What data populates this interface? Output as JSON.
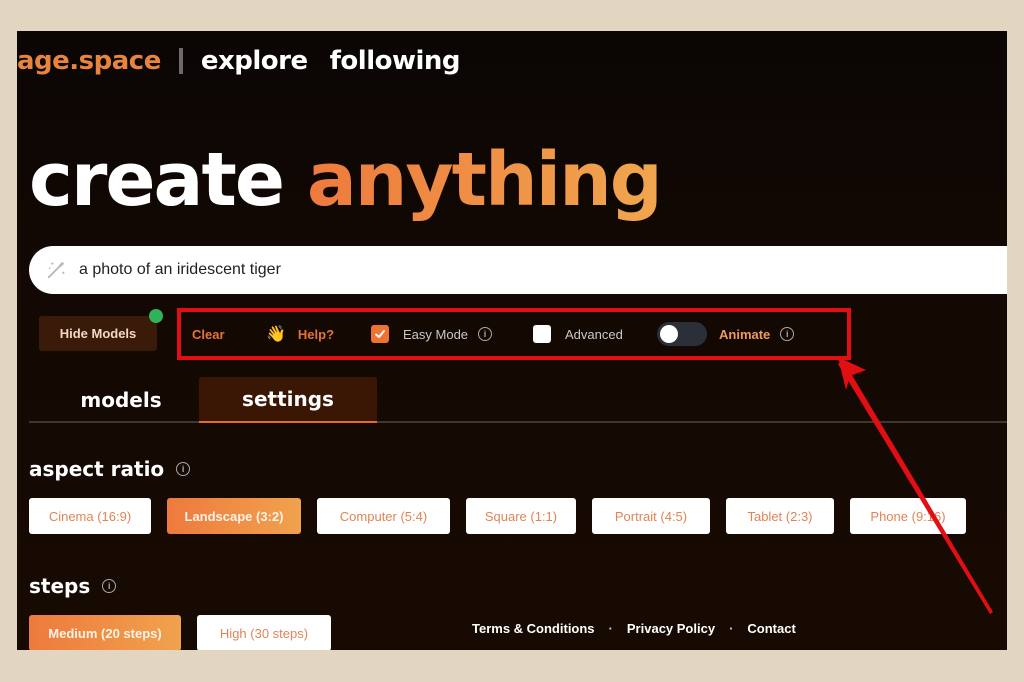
{
  "nav": {
    "brand": "age.space",
    "links": [
      "explore",
      "following"
    ]
  },
  "hero": {
    "word1": "create",
    "word2": "anything"
  },
  "prompt": {
    "icon": "magic-wand-icon",
    "value": "a photo of an iridescent tiger"
  },
  "controls": {
    "hide_models": "Hide Models",
    "clear": "Clear",
    "help_emoji": "👋",
    "help": "Help?",
    "easy_mode": {
      "label": "Easy Mode",
      "checked": true
    },
    "advanced": {
      "label": "Advanced",
      "checked": false
    },
    "animate": {
      "label": "Animate",
      "on": false
    }
  },
  "tabs": [
    {
      "label": "models",
      "active": false
    },
    {
      "label": "settings",
      "active": true
    }
  ],
  "aspect_ratio": {
    "title": "aspect ratio",
    "options": [
      {
        "label": "Cinema (16:9)",
        "active": false
      },
      {
        "label": "Landscape (3:2)",
        "active": true
      },
      {
        "label": "Computer (5:4)",
        "active": false
      },
      {
        "label": "Square (1:1)",
        "active": false
      },
      {
        "label": "Portrait (4:5)",
        "active": false
      },
      {
        "label": "Tablet (2:3)",
        "active": false
      },
      {
        "label": "Phone (9:16)",
        "active": false
      }
    ]
  },
  "steps": {
    "title": "steps",
    "options": [
      {
        "label": "Medium (20 steps)",
        "active": true
      },
      {
        "label": "High (30 steps)",
        "active": false
      }
    ]
  },
  "footer": {
    "links": [
      "Terms & Conditions",
      "Privacy Policy",
      "Contact"
    ],
    "separator": "·"
  },
  "colors": {
    "accent": "#ee7a3d",
    "highlight_annotation": "#e10f13",
    "status_dot": "#2fb35a"
  }
}
